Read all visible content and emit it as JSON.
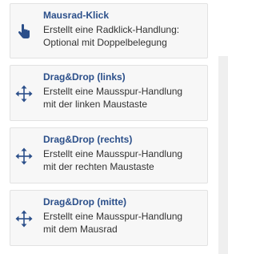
{
  "colors": {
    "accent": "#2b4f8a",
    "text": "#333333",
    "card_bg": "#f7f7f7",
    "card_border": "#e2e2e2"
  },
  "items": [
    {
      "title": "Mausrad-Klick",
      "line1": "Erstellt eine Radklick-Handlung:",
      "line2": "Optional mit Doppelbelegung",
      "icon": "hand-pointer-icon"
    },
    {
      "title": "Drag&Drop (links)",
      "line1": "Erstellt eine Mausspur-Handlung",
      "line2": "mit der linken Maustaste",
      "icon": "move-arrows-icon"
    },
    {
      "title": "Drag&Drop (rechts)",
      "line1": "Erstellt eine Mausspur-Handlung",
      "line2": "mit der rechten Maustaste",
      "icon": "move-arrows-icon"
    },
    {
      "title": "Drag&Drop (mitte)",
      "line1": "Erstellt eine Mausspur-Handlung",
      "line2": "mit dem Mausrad",
      "icon": "move-arrows-icon"
    }
  ]
}
